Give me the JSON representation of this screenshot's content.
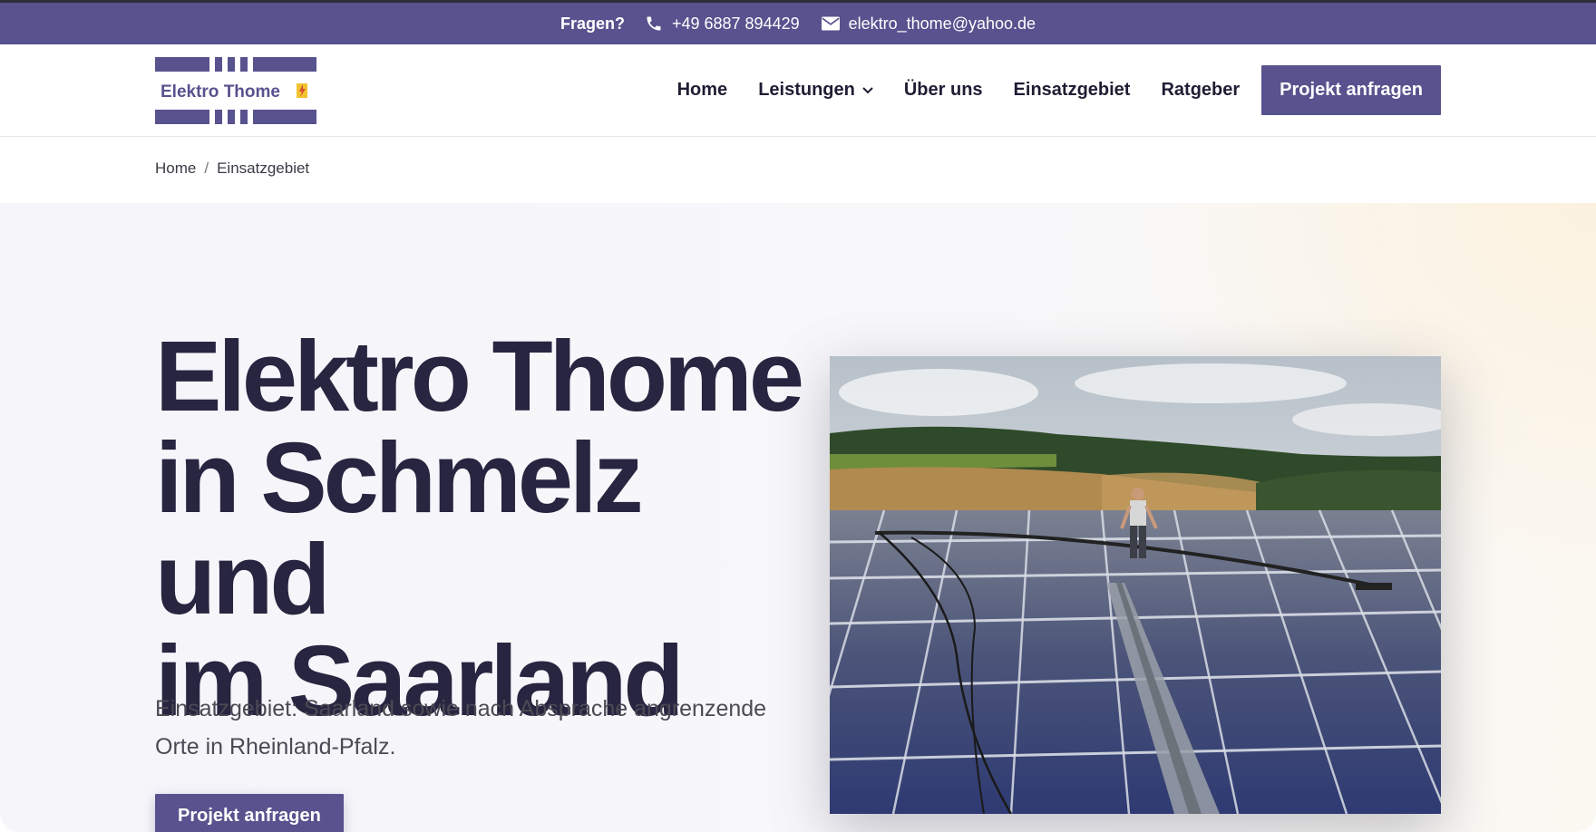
{
  "topbar": {
    "question": "Fragen?",
    "phone": "+49 6887 894429",
    "email": "elektro_thome@yahoo.de",
    "phone_icon": "phone-icon",
    "email_icon": "envelope-icon"
  },
  "brand": {
    "name": "Elektro Thome",
    "color": "#58528e"
  },
  "nav": {
    "items": [
      {
        "label": "Home"
      },
      {
        "label": "Leistungen"
      },
      {
        "label": "Über uns"
      },
      {
        "label": "Einsatzgebiet"
      },
      {
        "label": "Ratgeber"
      }
    ],
    "cta": "Projekt anfragen"
  },
  "breadcrumb": {
    "items": [
      "Home",
      "Einsatzgebiet"
    ],
    "separator": "/"
  },
  "hero": {
    "title_line1": "Elektro Thome",
    "title_line2": "in Schmelz und",
    "title_line3": "im Saarland",
    "lead": "Einsatzgebiet: Saarland sowie nach Absprache angrenzende Orte in Rheinland-Pfalz.",
    "cta": "Projekt anfragen",
    "image": "photo of a worker cleaning solar panels on a roof"
  }
}
